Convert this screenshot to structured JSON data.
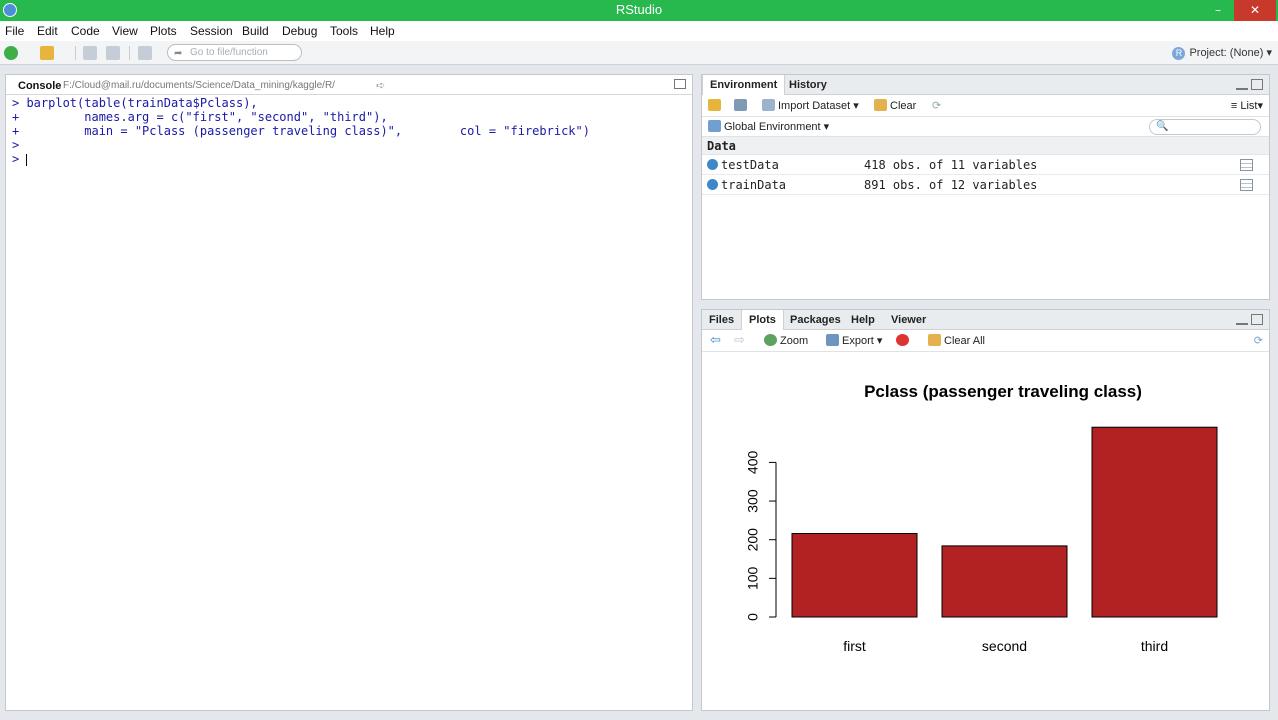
{
  "window": {
    "title": "RStudio",
    "minimize": "–",
    "maximize": "🗗",
    "close": "✕"
  },
  "menu": [
    "File",
    "Edit",
    "Code",
    "View",
    "Plots",
    "Session",
    "Build",
    "Debug",
    "Tools",
    "Help"
  ],
  "toolbar": {
    "goto_placeholder": "Go to file/function",
    "project_label": "Project: (None)"
  },
  "console": {
    "title": "Console",
    "path": "F:/Cloud@mail.ru/documents/Science/Data_mining/kaggle/R/",
    "lines": [
      "> barplot(table(trainData$Pclass),",
      "+         names.arg = c(\"first\", \"second\", \"third\"),",
      "+         main = \"Pclass (passenger traveling class)\",        col = \"firebrick\")",
      ">",
      "> "
    ]
  },
  "environment": {
    "tabs": [
      "Environment",
      "History"
    ],
    "toolbar": {
      "import": "Import Dataset",
      "clear": "Clear",
      "list": "List"
    },
    "scope": "Global Environment",
    "section": "Data",
    "rows": [
      {
        "name": "testData",
        "value": "418 obs. of 11 variables"
      },
      {
        "name": "trainData",
        "value": "891 obs. of 12 variables"
      }
    ]
  },
  "plots": {
    "tabs": [
      "Files",
      "Plots",
      "Packages",
      "Help",
      "Viewer"
    ],
    "toolbar": {
      "zoom": "Zoom",
      "export": "Export",
      "clear_all": "Clear All"
    }
  },
  "colors": {
    "titlebar": "#28b94e",
    "bar": "#b22222",
    "console_text": "#1a1aa6"
  },
  "chart_data": {
    "type": "bar",
    "title": "Pclass (passenger traveling class)",
    "categories": [
      "first",
      "second",
      "third"
    ],
    "values": [
      216,
      184,
      491
    ],
    "yticks": [
      0,
      100,
      200,
      300,
      400
    ],
    "ylim": [
      0,
      491
    ],
    "xlabel": "",
    "ylabel": "",
    "color": "#b22222"
  }
}
